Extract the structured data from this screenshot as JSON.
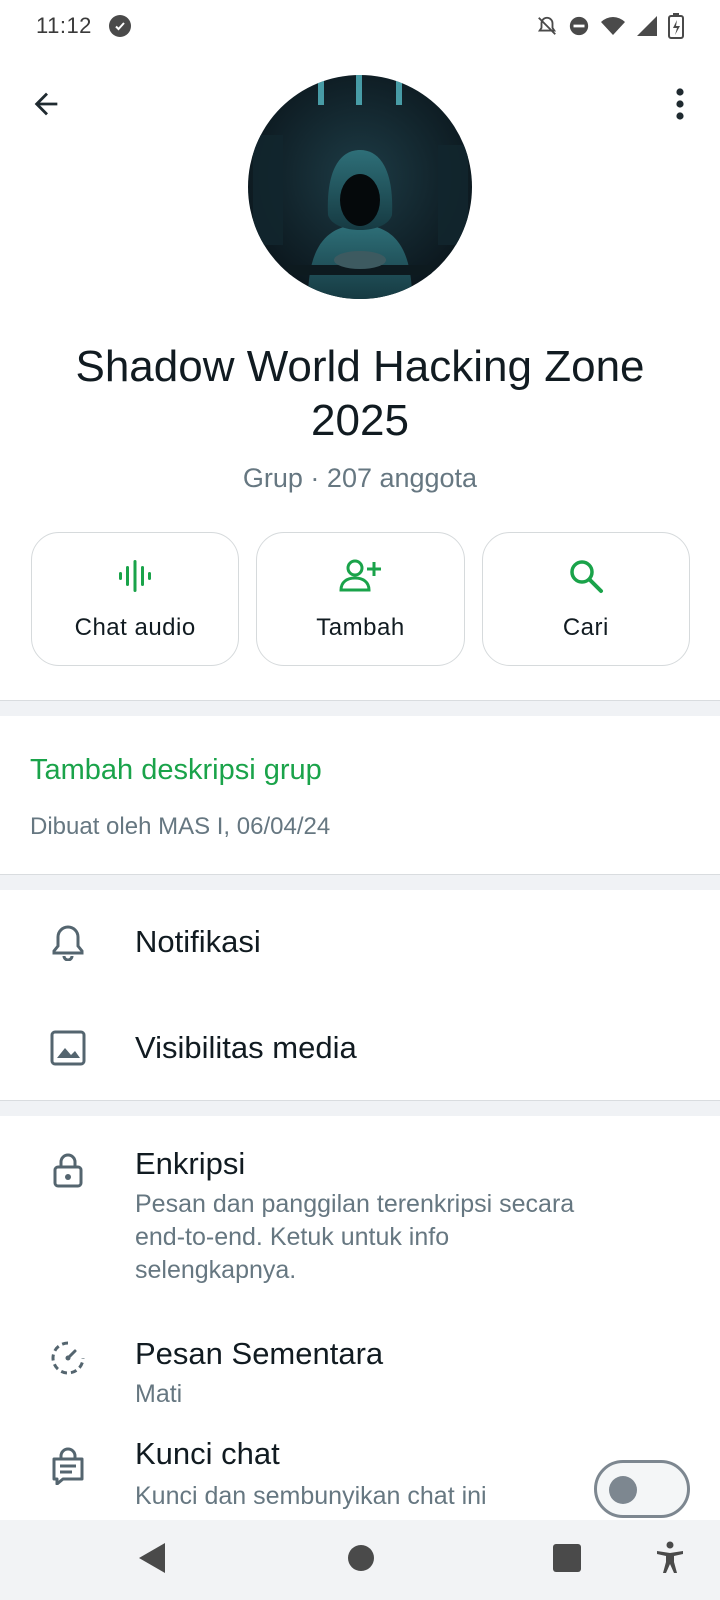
{
  "status_bar": {
    "time": "11:12",
    "icons": [
      "whatsapp-status-icon",
      "bell-off-icon",
      "dnd-icon",
      "wifi-icon",
      "signal-icon",
      "battery-charging-icon"
    ]
  },
  "header": {
    "back_icon": "arrow-left-icon",
    "menu_icon": "more-vert-icon"
  },
  "group": {
    "title": "Shadow World Hacking Zone 2025",
    "subtitle": "Grup · 207 anggota"
  },
  "actions": [
    {
      "label": "Chat audio",
      "icon": "audio-wave-icon"
    },
    {
      "label": "Tambah",
      "icon": "add-person-icon"
    },
    {
      "label": "Cari",
      "icon": "search-icon"
    }
  ],
  "description": {
    "link": "Tambah deskripsi grup",
    "meta": "Dibuat oleh MAS I, 06/04/24"
  },
  "settings": {
    "notifications": {
      "title": "Notifikasi",
      "icon": "bell-icon"
    },
    "media": {
      "title": "Visibilitas media",
      "icon": "image-icon"
    },
    "encryption": {
      "title": "Enkripsi",
      "subtitle": "Pesan dan panggilan terenkripsi secara end-to-end. Ketuk untuk info selengkapnya.",
      "icon": "lock-icon"
    },
    "disappearing": {
      "title": "Pesan Sementara",
      "subtitle": "Mati",
      "icon": "timer-icon"
    },
    "chat_lock": {
      "title": "Kunci chat",
      "subtitle": "Kunci dan sembunyikan chat ini",
      "icon": "chat-lock-icon",
      "enabled": false
    }
  },
  "colors": {
    "accent": "#1aa34a",
    "text_primary": "#111b21",
    "text_secondary": "#667781"
  },
  "nav_bar": {
    "icons": [
      "back-triangle-icon",
      "home-circle-icon",
      "recents-square-icon",
      "accessibility-icon"
    ]
  }
}
